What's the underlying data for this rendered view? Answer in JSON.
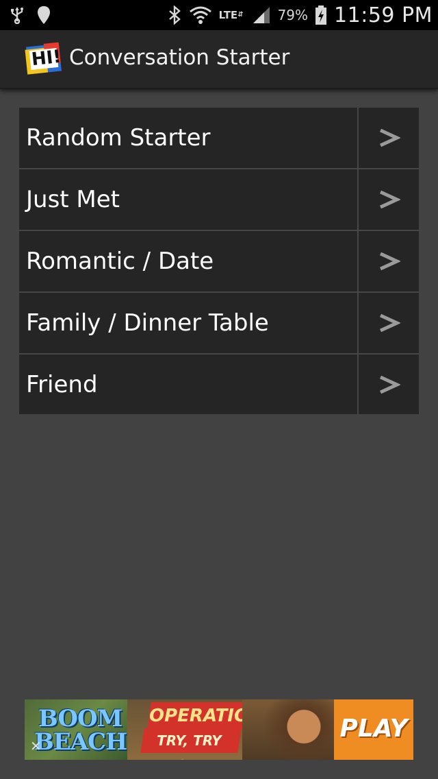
{
  "status_bar": {
    "network_type": "LTE",
    "battery_percent": "79%",
    "time": "11:59 PM"
  },
  "action_bar": {
    "logo_text": "HI!",
    "title": "Conversation Starter"
  },
  "menu": {
    "items": [
      {
        "label": "Random Starter",
        "arrow": ">"
      },
      {
        "label": "Just Met",
        "arrow": ">"
      },
      {
        "label": "Romantic / Date",
        "arrow": ">"
      },
      {
        "label": "Family / Dinner Table",
        "arrow": ">"
      },
      {
        "label": "Friend",
        "arrow": ">"
      }
    ]
  },
  "ad": {
    "brand_line1": "BOOM",
    "brand_line2": "BEACH",
    "headline": "OPERATION:",
    "subline": "TRY, TRY AGAIN",
    "cta": "PLAY",
    "close": "✕"
  },
  "colors": {
    "background": "#424242",
    "action_bar": "#262626",
    "menu_item": "#252525",
    "divider": "#464646",
    "ad_cta": "#ef8c22"
  },
  "icons": [
    "usb-icon",
    "location-icon",
    "bluetooth-icon",
    "wifi-icon",
    "signal-icon",
    "battery-charging-icon"
  ]
}
